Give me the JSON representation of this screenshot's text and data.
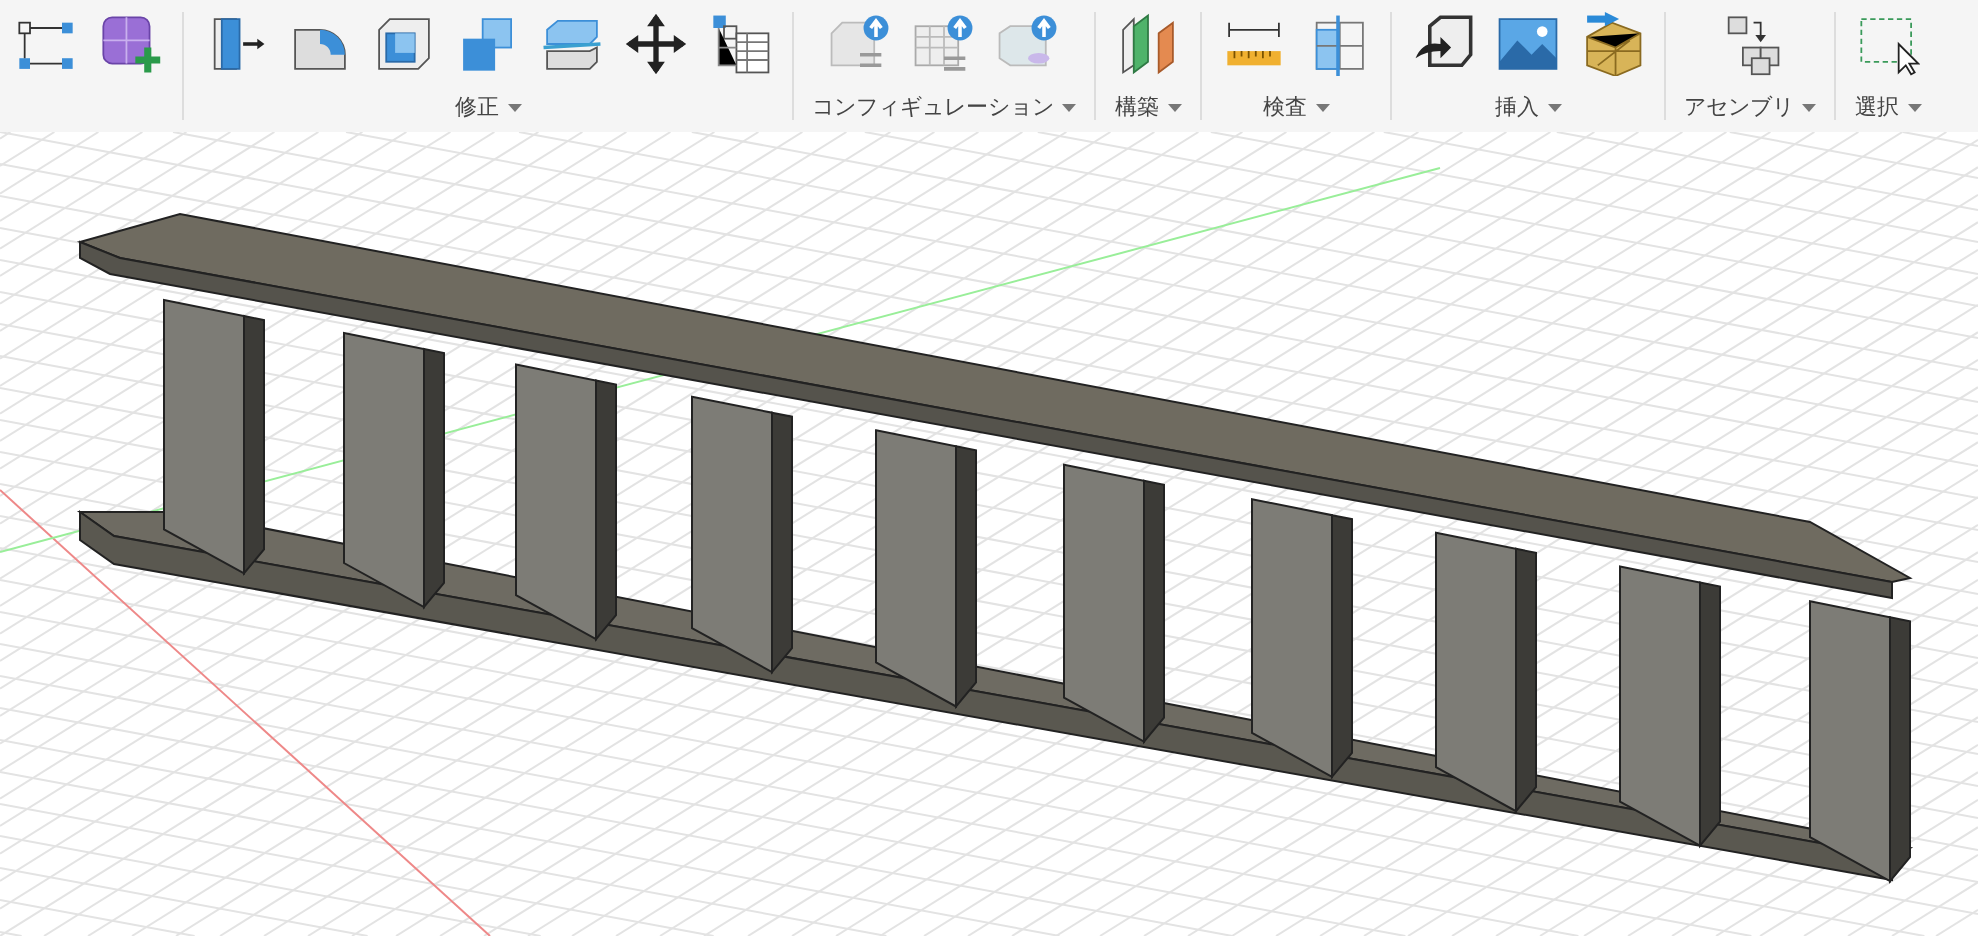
{
  "toolbar": {
    "groups": [
      {
        "label": "修正"
      },
      {
        "label": "コンフィギュレーション"
      },
      {
        "label": "構築"
      },
      {
        "label": "検査"
      },
      {
        "label": "挿入"
      },
      {
        "label": "アセンブリ"
      },
      {
        "label": "選択"
      }
    ]
  }
}
